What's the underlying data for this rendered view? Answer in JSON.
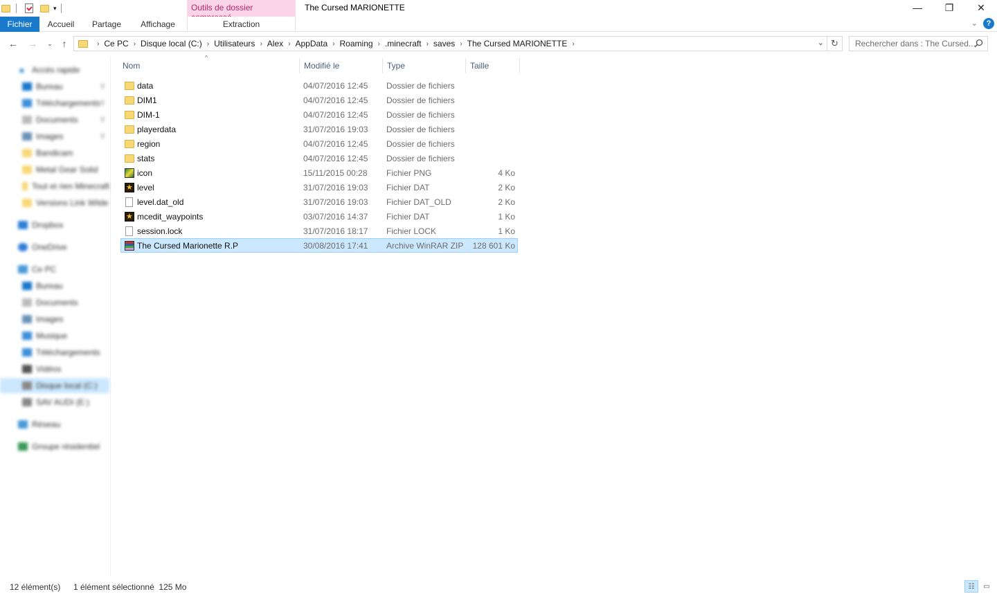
{
  "window": {
    "title": "The Cursed MARIONETTE",
    "context_tab_header": "Outils de dossier compressé",
    "minimize": "—",
    "maximize": "❐",
    "close": "✕"
  },
  "ribbon": {
    "tabs": [
      {
        "label": "Fichier"
      },
      {
        "label": "Accueil"
      },
      {
        "label": "Partage"
      },
      {
        "label": "Affichage"
      },
      {
        "label": "Extraction"
      }
    ],
    "help": "?"
  },
  "address": {
    "crumbs": [
      "Ce PC",
      "Disque local (C:)",
      "Utilisateurs",
      "Alex",
      "AppData",
      "Roaming",
      ".minecraft",
      "saves",
      "The Cursed MARIONETTE"
    ]
  },
  "search": {
    "placeholder": "Rechercher dans : The Cursed..."
  },
  "sidebar": {
    "items": [
      {
        "label": "Accès rapide",
        "icon": "star-icon"
      },
      {
        "label": "Bureau",
        "icon": "desktop-icon"
      },
      {
        "label": "Téléchargements",
        "icon": "download-icon"
      },
      {
        "label": "Documents",
        "icon": "documents-icon"
      },
      {
        "label": "Images",
        "icon": "images-icon"
      },
      {
        "label": "Bandicam",
        "icon": "folder-icon"
      },
      {
        "label": "Metal Gear Solid",
        "icon": "folder-icon"
      },
      {
        "label": "Tout et rien Minecraft",
        "icon": "folder-icon"
      },
      {
        "label": "Versions Link Wilde",
        "icon": "folder-icon"
      },
      {
        "label": "Dropbox",
        "icon": "dropbox-icon"
      },
      {
        "label": "OneDrive",
        "icon": "cloud-icon"
      },
      {
        "label": "Ce PC",
        "icon": "computer-icon"
      },
      {
        "label": "Bureau",
        "icon": "desktop-icon"
      },
      {
        "label": "Documents",
        "icon": "documents-icon"
      },
      {
        "label": "Images",
        "icon": "images-icon"
      },
      {
        "label": "Musique",
        "icon": "music-icon"
      },
      {
        "label": "Téléchargements",
        "icon": "download-icon"
      },
      {
        "label": "Vidéos",
        "icon": "video-icon"
      },
      {
        "label": "Disque local (C:)",
        "icon": "drive-icon"
      },
      {
        "label": "SAV AUDI (E:)",
        "icon": "drive-icon"
      },
      {
        "label": "Réseau",
        "icon": "network-icon"
      },
      {
        "label": "Groupe résidentiel",
        "icon": "homegroup-icon"
      }
    ]
  },
  "columns": {
    "name": "Nom",
    "modified": "Modifié le",
    "type": "Type",
    "size": "Taille"
  },
  "files": [
    {
      "name": "data",
      "modified": "04/07/2016 12:45",
      "type": "Dossier de fichiers",
      "size": "",
      "icon": "folder-icon"
    },
    {
      "name": "DIM1",
      "modified": "04/07/2016 12:45",
      "type": "Dossier de fichiers",
      "size": "",
      "icon": "folder-icon"
    },
    {
      "name": "DIM-1",
      "modified": "04/07/2016 12:45",
      "type": "Dossier de fichiers",
      "size": "",
      "icon": "folder-icon"
    },
    {
      "name": "playerdata",
      "modified": "31/07/2016 19:03",
      "type": "Dossier de fichiers",
      "size": "",
      "icon": "folder-icon"
    },
    {
      "name": "region",
      "modified": "04/07/2016 12:45",
      "type": "Dossier de fichiers",
      "size": "",
      "icon": "folder-icon"
    },
    {
      "name": "stats",
      "modified": "04/07/2016 12:45",
      "type": "Dossier de fichiers",
      "size": "",
      "icon": "folder-icon"
    },
    {
      "name": "icon",
      "modified": "15/11/2015 00:28",
      "type": "Fichier PNG",
      "size": "4 Ko",
      "icon": "png-icon"
    },
    {
      "name": "level",
      "modified": "31/07/2016 19:03",
      "type": "Fichier DAT",
      "size": "2 Ko",
      "icon": "dat-icon"
    },
    {
      "name": "level.dat_old",
      "modified": "31/07/2016 19:03",
      "type": "Fichier DAT_OLD",
      "size": "2 Ko",
      "icon": "blank-file-icon"
    },
    {
      "name": "mcedit_waypoints",
      "modified": "03/07/2016 14:37",
      "type": "Fichier DAT",
      "size": "1 Ko",
      "icon": "dat-icon"
    },
    {
      "name": "session.lock",
      "modified": "31/07/2016 18:17",
      "type": "Fichier LOCK",
      "size": "1 Ko",
      "icon": "blank-file-icon"
    },
    {
      "name": "The Cursed Marionette R.P",
      "modified": "30/08/2016 17:41",
      "type": "Archive WinRAR ZIP",
      "size": "128 601 Ko",
      "icon": "winrar-icon",
      "selected": true
    }
  ],
  "status": {
    "count": "12 élément(s)",
    "selection": "1 élément sélectionné  125 Mo"
  },
  "colors": {
    "accent": "#1979ca",
    "selection": "#cce8ff",
    "selection_border": "#99d1ff",
    "context_tab": "#f9d5e7"
  }
}
